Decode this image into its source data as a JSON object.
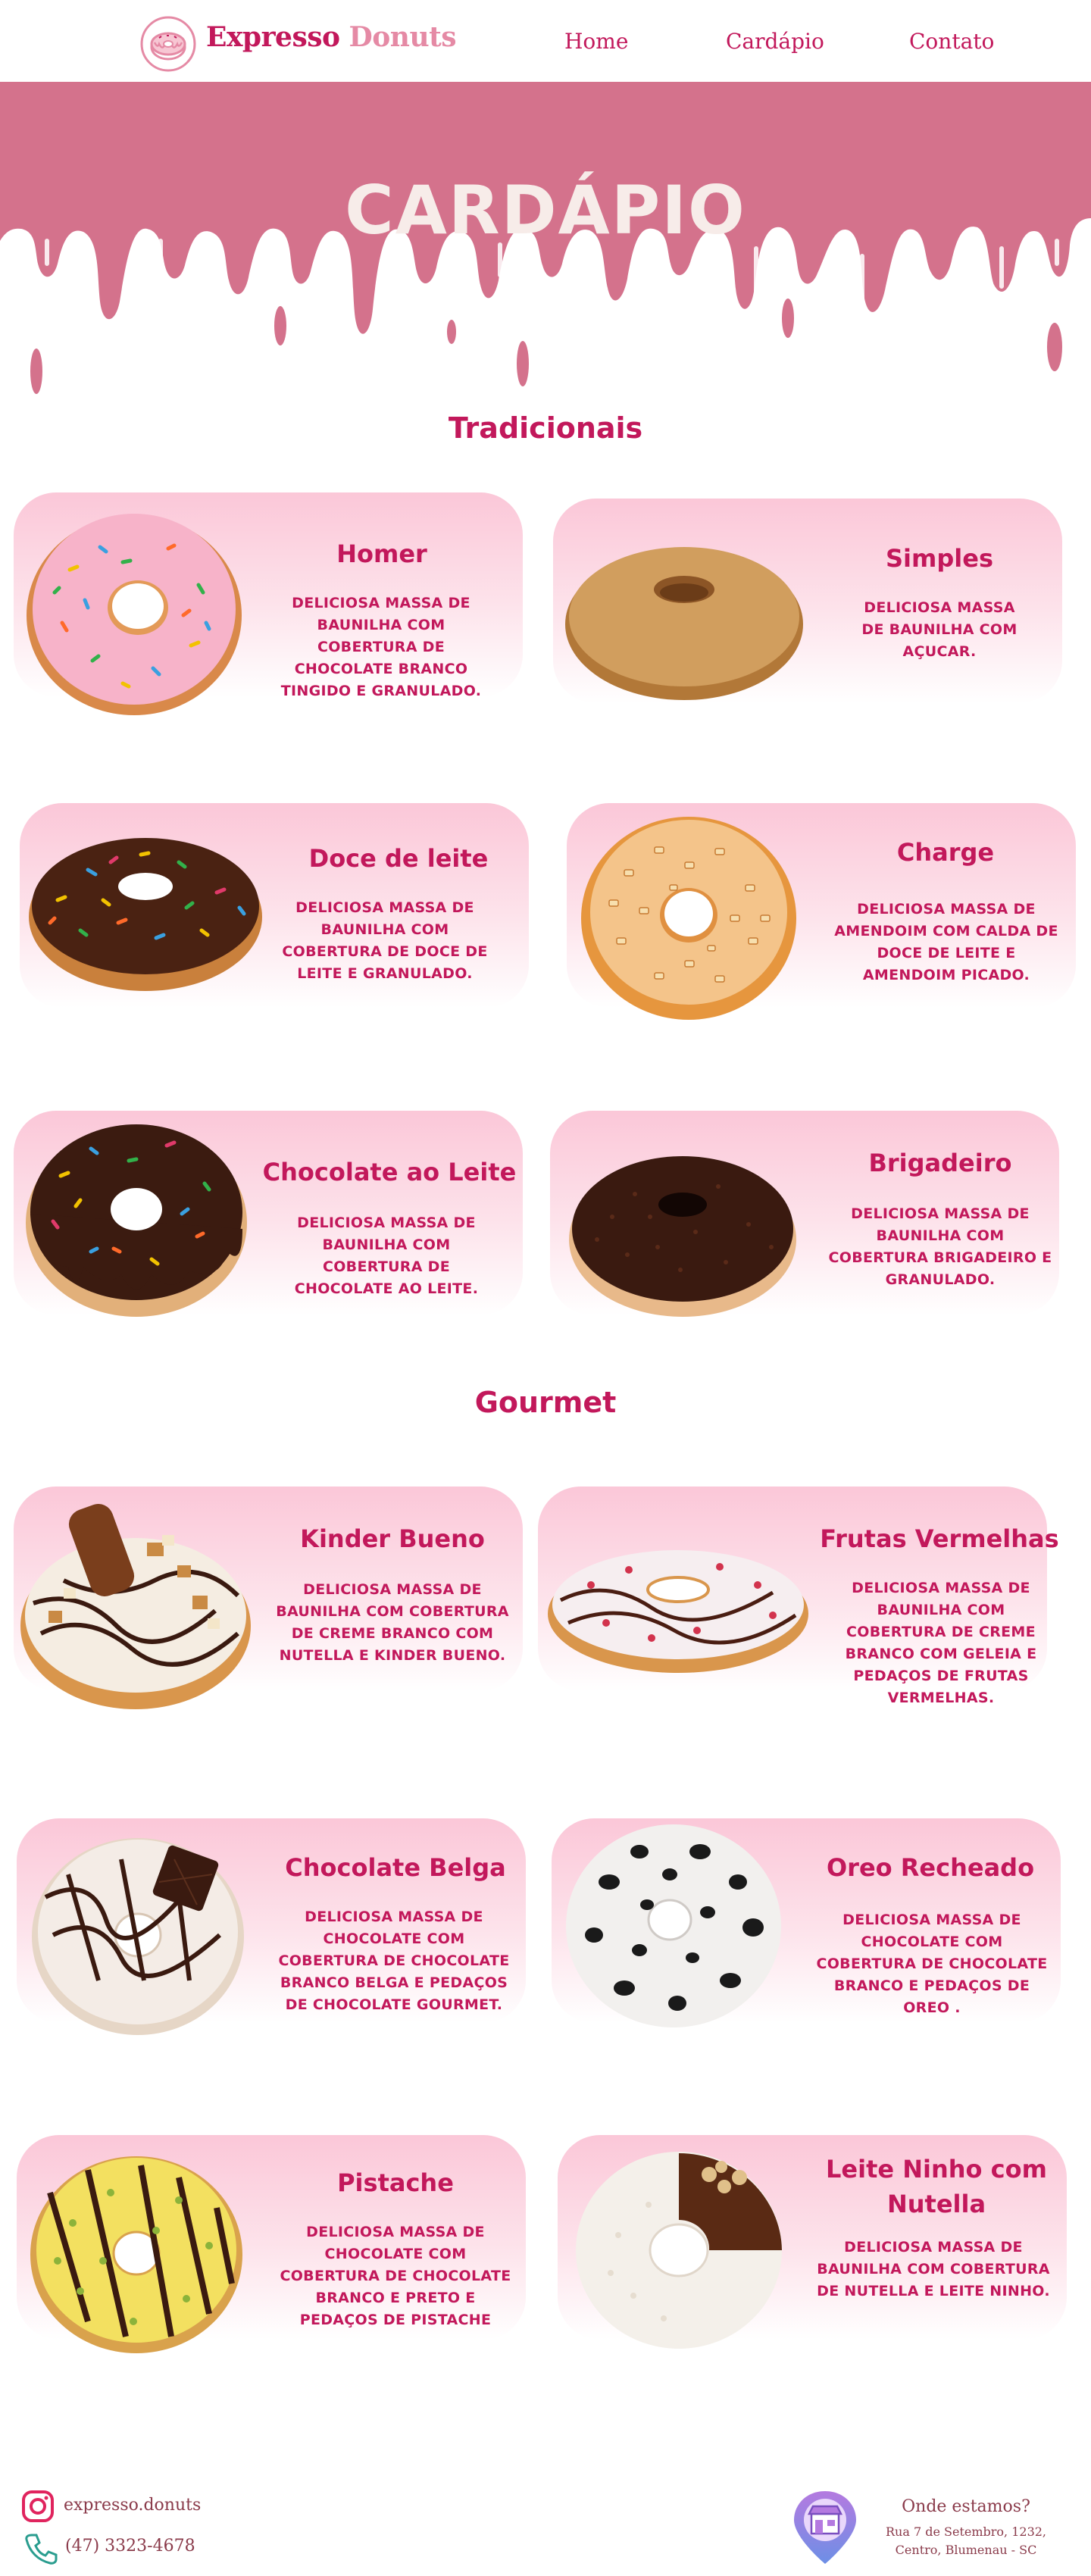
{
  "header": {
    "brand_part1": "Expresso",
    "brand_part2": "Donuts",
    "nav": [
      {
        "label": "Home"
      },
      {
        "label": "Cardápio"
      },
      {
        "label": "Contato"
      }
    ]
  },
  "hero": {
    "title": "CARDÁPIO"
  },
  "sections": [
    {
      "title": "Tradicionais",
      "items": [
        {
          "name": "Homer",
          "description": "DELICIOSA MASSA DE BAUNILHA COM COBERTURA DE CHOCOLATE BRANCO TINGIDO E GRANULADO."
        },
        {
          "name": "Simples",
          "description": "DELICIOSA MASSA DE BAUNILHA COM AÇUCAR."
        },
        {
          "name": "Doce de leite",
          "description": "DELICIOSA MASSA DE BAUNILHA COM COBERTURA DE DOCE DE LEITE E GRANULADO."
        },
        {
          "name": "Charge",
          "description": "DELICIOSA MASSA DE AMENDOIM COM CALDA DE DOCE DE LEITE E AMENDOIM PICADO."
        },
        {
          "name": "Chocolate ao Leite",
          "description": "DELICIOSA MASSA DE BAUNILHA COM COBERTURA DE CHOCOLATE AO LEITE."
        },
        {
          "name": "Brigadeiro",
          "description": "DELICIOSA MASSA DE BAUNILHA COM COBERTURA BRIGADEIRO E GRANULADO."
        }
      ]
    },
    {
      "title": "Gourmet",
      "items": [
        {
          "name": "Kinder Bueno",
          "description": "DELICIOSA MASSA DE BAUNILHA COM COBERTURA DE CREME BRANCO COM NUTELLA E KINDER BUENO."
        },
        {
          "name": "Frutas Vermelhas",
          "description": "DELICIOSA MASSA DE BAUNILHA COM COBERTURA DE CREME BRANCO COM GELEIA E PEDAÇOS DE FRUTAS VERMELHAS."
        },
        {
          "name": "Chocolate Belga",
          "description": "DELICIOSA MASSA DE CHOCOLATE COM COBERTURA DE CHOCOLATE BRANCO BELGA E PEDAÇOS DE CHOCOLATE GOURMET."
        },
        {
          "name": "Oreo Recheado",
          "description": "DELICIOSA MASSA DE CHOCOLATE COM COBERTURA DE CHOCOLATE BRANCO E PEDAÇOS DE OREO ."
        },
        {
          "name": "Pistache",
          "description": "DELICIOSA MASSA DE CHOCOLATE COM COBERTURA DE CHOCOLATE BRANCO E PRETO E PEDAÇOS DE PISTACHE"
        },
        {
          "name": "Leite Ninho com Nutella",
          "description": "DELICIOSA MASSA DE BAUNILHA COM COBERTURA DE NUTELLA E LEITE NINHO."
        }
      ]
    }
  ],
  "footer": {
    "instagram": "expresso.donuts",
    "phone": "(47) 3323-4678",
    "location_title": "Onde estamos?",
    "address": "Rua 7 de Setembro, 1232, Centro, Blumenau - SC"
  },
  "colors": {
    "accent": "#c2185b",
    "drip": "#d4728c",
    "hero_title": "#f7ece9",
    "card_top": "#fbc7d8",
    "card_bottom": "#ffffff"
  },
  "icons": [
    "donut-logo-icon",
    "instagram-icon",
    "phone-icon",
    "map-pin-store-icon"
  ]
}
